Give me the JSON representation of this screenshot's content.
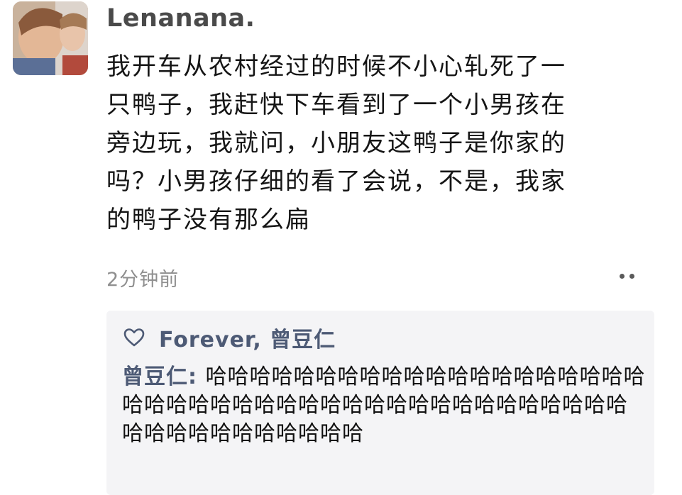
{
  "post": {
    "author": "Lenanana.",
    "lines": [
      "我开车从农村经过的时候不小心轧死了一",
      "只鸭子，我赶快下车看到了一个小男孩在",
      "旁边玩，我就问，小朋友这鸭子是你家的",
      "吗？小男孩仔细的看了会说，不是，我家",
      "的鸭子没有那么扁"
    ],
    "timestamp": "2分钟前"
  },
  "likes": {
    "icon": "heart-icon",
    "names": "Forever, 曾豆仁"
  },
  "comment": {
    "author": "曾豆仁",
    "separator": ": ",
    "text": "哈哈哈哈哈哈哈哈哈哈哈哈哈哈哈哈哈哈哈哈哈哈哈哈哈哈哈哈哈哈哈哈哈哈哈哈哈哈哈哈哈哈哈哈哈哈哈哈哈哈哈哈哈哈"
  },
  "colors": {
    "link": "#4d5a75",
    "timestamp": "#8f8f8f",
    "comment_bg": "#f4f4f6"
  }
}
